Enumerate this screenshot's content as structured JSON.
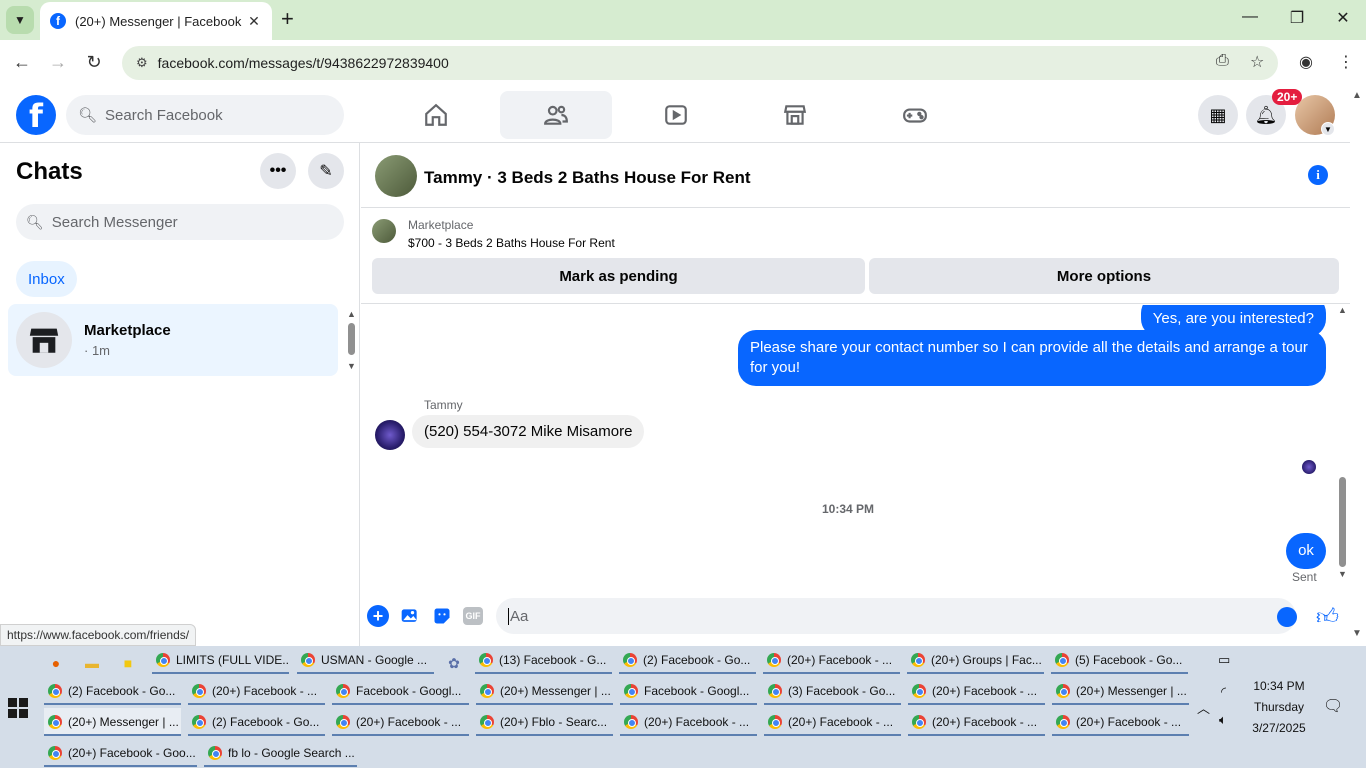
{
  "browser": {
    "tab_title": "(20+) Messenger | Facebook",
    "url": "facebook.com/messages/t/9438622972839400",
    "status_url": "https://www.facebook.com/friends/"
  },
  "fb_header": {
    "search_placeholder": "Search Facebook",
    "notification_count": "20+"
  },
  "sidebar": {
    "title": "Chats",
    "search_placeholder": "Search Messenger",
    "inbox_label": "Inbox",
    "chats": [
      {
        "name": "Marketplace",
        "time": "· 1m"
      }
    ]
  },
  "conversation": {
    "title": "Tammy · 3 Beds 2 Baths House For Rent",
    "marketplace_label": "Marketplace",
    "listing": "$700 - 3 Beds 2 Baths House For Rent",
    "mark_pending_label": "Mark as pending",
    "more_options_label": "More options",
    "messages": [
      {
        "from": "me",
        "text": "Yes, are you interested?"
      },
      {
        "from": "me",
        "text": "Please share your contact number so I can provide all the details and arrange a tour for you!"
      },
      {
        "from": "Tammy",
        "sender_label": "Tammy",
        "text": "(520) 554-3072 Mike Misamore"
      },
      {
        "from": "me",
        "text": "ok",
        "status": "Sent"
      }
    ],
    "timestamp": "10:34 PM",
    "composer_placeholder": "Aa"
  },
  "taskbar": {
    "rows": [
      [
        "LIMITS (FULL VIDE...",
        "USMAN - Google ...",
        "(13) Facebook - G...",
        "(2) Facebook - Go...",
        "(20+) Facebook - ...",
        "(20+) Groups | Fac...",
        "(5) Facebook - Go..."
      ],
      [
        "(2) Facebook - Go...",
        "(20+) Facebook - ...",
        "Facebook - Googl...",
        "(20+) Messenger | ...",
        "Facebook - Googl...",
        "(3) Facebook - Go...",
        "(20+) Facebook - ...",
        "(20+) Messenger | ..."
      ],
      [
        "(20+) Messenger | ...",
        "(2) Facebook - Go...",
        "(20+) Facebook - ...",
        "(20+) Fblo - Searc...",
        "(20+) Facebook - ...",
        "(20+) Facebook - ...",
        "(20+) Facebook - ...",
        "(20+) Facebook - ..."
      ],
      [
        "(20+) Facebook - Goo...",
        "fb lo - Google Search ..."
      ]
    ],
    "time": "10:34 PM",
    "day": "Thursday",
    "date": "3/27/2025"
  }
}
